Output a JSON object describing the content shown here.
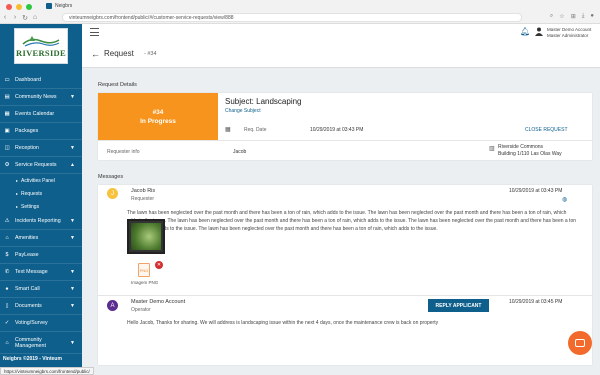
{
  "browser": {
    "tab_title": "Neigbrs",
    "url": "vinteumneigbrs.com/frontend/public/#/customer-service-requests/view/888",
    "status_url": "https://vinteumneigbrs.com/frontend/public/"
  },
  "logo": {
    "text": "RIVERSIDE"
  },
  "sidebar": {
    "items": [
      {
        "label": "Dashboard",
        "icon": "monitor-icon"
      },
      {
        "label": "Community News",
        "icon": "news-icon",
        "chevron": true
      },
      {
        "label": "Events Calendar",
        "icon": "calendar-icon"
      },
      {
        "label": "Packages",
        "icon": "package-icon"
      },
      {
        "label": "Reception",
        "icon": "reception-icon",
        "chevron": true
      },
      {
        "label": "Service Requests",
        "icon": "service-icon",
        "chevron": true,
        "expanded": true
      },
      {
        "label": "Activities Panel",
        "sub": true
      },
      {
        "label": "Requests",
        "sub": true
      },
      {
        "label": "Settings",
        "sub": true
      },
      {
        "label": "Incidents Reporting",
        "icon": "warning-icon",
        "chevron": true
      },
      {
        "label": "Amenities",
        "icon": "amenities-icon",
        "chevron": true
      },
      {
        "label": "PayLease",
        "icon": "dollar-icon"
      },
      {
        "label": "Text Message",
        "icon": "phone-icon",
        "chevron": true
      },
      {
        "label": "Smart Call",
        "icon": "mic-icon",
        "chevron": true
      },
      {
        "label": "Documents",
        "icon": "document-icon",
        "chevron": true
      },
      {
        "label": "Voting/Survey",
        "icon": "vote-icon"
      },
      {
        "label": "Community Management",
        "icon": "community-icon",
        "chevron": true
      }
    ],
    "footer": "Neigbrs ©2019 - Vinteum"
  },
  "topbar": {
    "user_name": "Master Demo Account",
    "user_role": "Master Administrator"
  },
  "page": {
    "title": "Request",
    "number": "- #34"
  },
  "request_details": {
    "section_title": "Request Details",
    "request_id": "#34",
    "status": "In Progress",
    "subject": "Subject: Landscaping",
    "change_subject": "Change Subject",
    "req_date_label": "Req. Date",
    "req_date_value": "10/29/2019 at 03:43 PM",
    "close_request": "CLOSE REQUEST",
    "requester_info_label": "Requester info",
    "requester_name": "Jacob",
    "building_name": "Riverside Commons",
    "building_address": "Building 1/110 Las Olas Way"
  },
  "messages": {
    "section_title": "Messages",
    "items": [
      {
        "avatar": "J",
        "avatar_color": "#f7c23e",
        "name": "Jacob Ris",
        "role": "Requester",
        "date": "10/29/2019 at 03:43 PM",
        "body": "The lawn has been neglected over the past month and there has been a ton of rain, which adds to the issue. The lawn has been neglected over the past month and there has been a ton of rain, which adds to the issue. The lawn has been neglected over the past month and there has been a ton of rain, which adds to the issue. The lawn has been neglected over the past month and there has been a ton of rain, which adds to the issue. The lawn has been neglected over the past month and there has been a ton of rain, which adds to the issue.",
        "attachment_name": "Imagem PNG",
        "attachment_type": "PNG"
      },
      {
        "avatar": "A",
        "avatar_color": "#5b2d8f",
        "name": "Master Demo Account",
        "role": "Operator",
        "date": "10/29/2019 at 03:45 PM",
        "body": "Hello Jacob, Thanks for sharing. We will address is landscaping issue within the next 4 days, once the maintenance crew is back on property"
      }
    ],
    "reply_button": "REPLY APPLICANT"
  },
  "colors": {
    "sidebar": "#0e5f8c",
    "status_orange": "#f7941d",
    "chat_bubble": "#f26b2c"
  }
}
